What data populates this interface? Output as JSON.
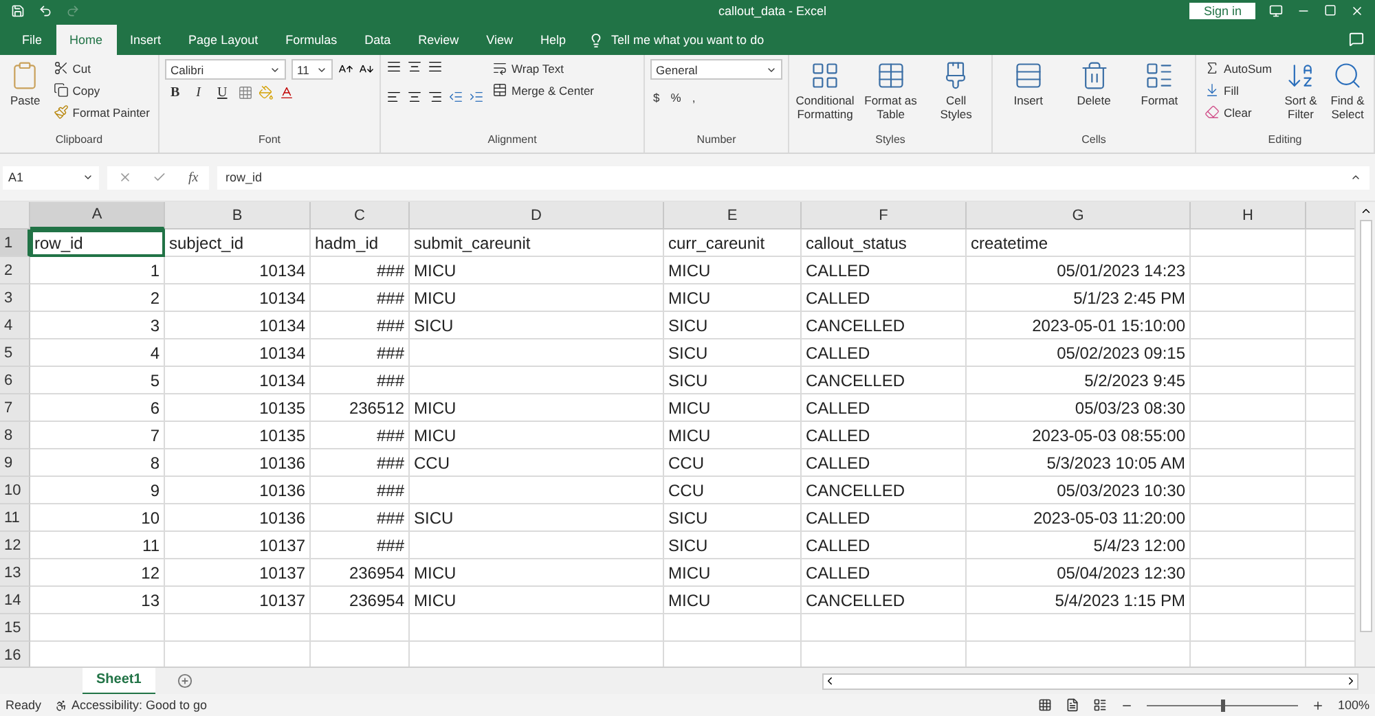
{
  "title_bar": {
    "title": "callout_data  -  Excel",
    "sign_in": "Sign in"
  },
  "menu_tabs": [
    {
      "label": "File",
      "selected": false
    },
    {
      "label": "Home",
      "selected": true
    },
    {
      "label": "Insert",
      "selected": false
    },
    {
      "label": "Page Layout",
      "selected": false
    },
    {
      "label": "Formulas",
      "selected": false
    },
    {
      "label": "Data",
      "selected": false
    },
    {
      "label": "Review",
      "selected": false
    },
    {
      "label": "View",
      "selected": false
    },
    {
      "label": "Help",
      "selected": false
    }
  ],
  "tell_me": "Tell me what you want to do",
  "ribbon": [
    {
      "kind": "clipboard",
      "name": "Clipboard",
      "items": [
        "Paste",
        "Cut",
        "Copy",
        "Format Painter"
      ]
    },
    {
      "kind": "font",
      "name": "Font",
      "font_name": "Calibri",
      "font_size": "11",
      "items": [
        "B",
        "I",
        "U"
      ]
    },
    {
      "kind": "alignment",
      "name": "Alignment",
      "items": [
        "Wrap Text",
        "Merge & Center"
      ]
    },
    {
      "kind": "number",
      "name": "Number",
      "format": "General",
      "items": [
        "$",
        "%",
        ","
      ]
    },
    {
      "kind": "large",
      "name": "Styles",
      "items": [
        "Conditional Formatting",
        "Format as Table",
        "Cell Styles"
      ]
    },
    {
      "kind": "large",
      "name": "Cells",
      "items": [
        "Insert",
        "Delete",
        "Format"
      ]
    },
    {
      "kind": "editing",
      "name": "Editing",
      "items": [
        "AutoSum",
        "Fill",
        "Clear",
        "Sort & Filter",
        "Find & Select"
      ]
    }
  ],
  "formula_bar": {
    "name_box": "A1",
    "function_label": "fx",
    "value": "row_id"
  },
  "columns": [
    {
      "letter": "A",
      "selected": true
    },
    {
      "letter": "B",
      "selected": false
    },
    {
      "letter": "C",
      "selected": false
    },
    {
      "letter": "D",
      "selected": false
    },
    {
      "letter": "E",
      "selected": false
    },
    {
      "letter": "F",
      "selected": false
    },
    {
      "letter": "G",
      "selected": false
    },
    {
      "letter": "H",
      "selected": false
    }
  ],
  "rows": [
    {
      "number": "1",
      "kind": "header",
      "selected": true,
      "cells": [
        "row_id",
        "subject_id",
        "hadm_id",
        "submit_careunit",
        "curr_careunit",
        "callout_status",
        "createtime",
        null
      ]
    },
    {
      "number": "2",
      "kind": "data",
      "selected": false,
      "cells": [
        "1",
        "10134",
        "###",
        "MICU",
        "MICU",
        "CALLED",
        "05/01/2023 14:23",
        null
      ]
    },
    {
      "number": "3",
      "kind": "data",
      "selected": false,
      "cells": [
        "2",
        "10134",
        "###",
        "MICU",
        "MICU",
        "CALLED",
        "5/1/23 2:45 PM",
        null
      ]
    },
    {
      "number": "4",
      "kind": "data",
      "selected": false,
      "cells": [
        "3",
        "10134",
        "###",
        "SICU",
        "SICU",
        "CANCELLED",
        "2023-05-01 15:10:00",
        null
      ]
    },
    {
      "number": "5",
      "kind": "data",
      "selected": false,
      "cells": [
        "4",
        "10134",
        "###",
        null,
        "SICU",
        "CALLED",
        "05/02/2023 09:15",
        null
      ]
    },
    {
      "number": "6",
      "kind": "data",
      "selected": false,
      "cells": [
        "5",
        "10134",
        "###",
        null,
        "SICU",
        "CANCELLED",
        "5/2/2023 9:45",
        null
      ]
    },
    {
      "number": "7",
      "kind": "data",
      "selected": false,
      "cells": [
        "6",
        "10135",
        "236512",
        "MICU",
        "MICU",
        "CALLED",
        "05/03/23 08:30",
        null
      ]
    },
    {
      "number": "8",
      "kind": "data",
      "selected": false,
      "cells": [
        "7",
        "10135",
        "###",
        "MICU",
        "MICU",
        "CALLED",
        "2023-05-03 08:55:00",
        null
      ]
    },
    {
      "number": "9",
      "kind": "data",
      "selected": false,
      "cells": [
        "8",
        "10136",
        "###",
        "CCU",
        "CCU",
        "CALLED",
        "5/3/2023 10:05 AM",
        null
      ]
    },
    {
      "number": "10",
      "kind": "data",
      "selected": false,
      "cells": [
        "9",
        "10136",
        "###",
        null,
        "CCU",
        "CANCELLED",
        "05/03/2023 10:30",
        null
      ]
    },
    {
      "number": "11",
      "kind": "data",
      "selected": false,
      "cells": [
        "10",
        "10136",
        "###",
        "SICU",
        "SICU",
        "CALLED",
        "2023-05-03 11:20:00",
        null
      ]
    },
    {
      "number": "12",
      "kind": "data",
      "selected": false,
      "cells": [
        "11",
        "10137",
        "###",
        null,
        "SICU",
        "CALLED",
        "5/4/23 12:00",
        null
      ]
    },
    {
      "number": "13",
      "kind": "data",
      "selected": false,
      "cells": [
        "12",
        "10137",
        "236954",
        "MICU",
        "MICU",
        "CALLED",
        "05/04/2023 12:30",
        null
      ]
    },
    {
      "number": "14",
      "kind": "data",
      "selected": false,
      "cells": [
        "13",
        "10137",
        "236954",
        "MICU",
        "MICU",
        "CANCELLED",
        "5/4/2023 1:15 PM",
        null
      ]
    },
    {
      "number": "15",
      "kind": "data",
      "selected": false,
      "cells": [
        null,
        null,
        null,
        null,
        null,
        null,
        null,
        null
      ]
    },
    {
      "number": "16",
      "kind": "data",
      "selected": false,
      "cells": [
        null,
        null,
        null,
        null,
        null,
        null,
        null,
        null
      ]
    }
  ],
  "sheet_tabs": [
    {
      "label": "Sheet1",
      "selected": true
    }
  ],
  "status_bar": {
    "status": "Ready",
    "accessibility": "Accessibility: Good to go",
    "zoom": "100%",
    "zoom_level": {
      "level": 0.5
    }
  }
}
